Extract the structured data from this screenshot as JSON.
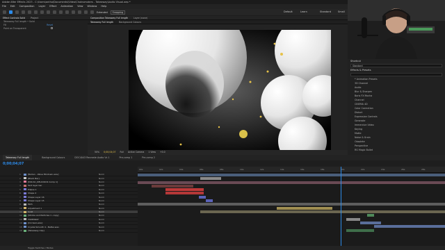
{
  "window": {
    "title": "Adobe After Effects 2023 - C:\\Users\\antho\\Documents\\Video\\Chainsmokers - Takeaway\\Audio Visual.aep *"
  },
  "menu": [
    "File",
    "Edit",
    "Composition",
    "Layer",
    "Effect",
    "Animation",
    "View",
    "Window",
    "Help"
  ],
  "toolbar": {
    "extended": "Extended",
    "snapping": "Snapping"
  },
  "workspaces": [
    "Default",
    "Learn",
    "Standard",
    "Small Screen",
    "Libraries"
  ],
  "left_panel": {
    "tabs": [
      "Effect Controls Solid",
      "Project"
    ],
    "breadcrumb": "Takeaway Full length • Solid",
    "rows": [
      {
        "label": "Fill",
        "value": "Reset"
      },
      {
        "label": "Paint on Transparent",
        "value": ""
      }
    ]
  },
  "comp_panel": {
    "tabs": [
      "Composition Takeaway Full length",
      "Layer (none)"
    ],
    "subtabs": [
      "Takeaway Full length",
      "Background Colours"
    ],
    "footer": [
      "50%",
      "0;00;04;07",
      "Full",
      "Active Camera",
      "1 View",
      "+0.0"
    ]
  },
  "right_panel": {
    "title": "Shortcut",
    "field_value": "Standard",
    "section": "Effects & Presets",
    "search_placeholder": "",
    "items": [
      "* Animation Presets",
      "3D Channel",
      "Audio",
      "Blur & Sharpen",
      "Boris FX Mocha",
      "Channel",
      "CINEMA 4D",
      "Color Correction",
      "Distort",
      "Expression Controls",
      "Generate",
      "Immersive Video",
      "Keying",
      "Matte",
      "Noise & Grain",
      "Obsolete",
      "Perspective",
      "RG Magic Bullet"
    ]
  },
  "timeline": {
    "tabs": [
      "Takeaway Full length",
      "Background Colours",
      "DOC4043 Recreate Audio Vs 1",
      "Pre-comp 1",
      "Pre-comp 2"
    ],
    "timecode": "0;00;04;07",
    "ruler": [
      "00s",
      "02s",
      "04s",
      "06s",
      "08s",
      "10s",
      "12s",
      "14s",
      "16s",
      "18s",
      "20s",
      "22s",
      "24s",
      "26s",
      "28s"
    ],
    "layers": [
      {
        "num": "1",
        "name": "[Nullen - Wave Mixdown.wav]",
        "color": "#6d8fc9",
        "mode": "Norm"
      },
      {
        "num": "2",
        "name": "[Black Bar]",
        "color": "#c8c8c8",
        "mode": "Norm"
      },
      {
        "num": "3",
        "name": "[MIX-SC_DELICIOUS Comp 1]",
        "color": "#e07a9a",
        "mode": "Norm"
      },
      {
        "num": "4",
        "name": "Text layer bar",
        "color": "#c46d6d",
        "mode": "Norm"
      },
      {
        "num": "5",
        "name": "Ellipse 1",
        "color": "#7a7ad6",
        "mode": "Norm"
      },
      {
        "num": "6",
        "name": "Shape 2",
        "color": "#7a7ad6",
        "mode": "Norm"
      },
      {
        "num": "7",
        "name": "Shape Layer 16",
        "color": "#7a7ad6",
        "mode": "Norm"
      },
      {
        "num": "8",
        "name": "Shape Layer 15",
        "color": "#7a7ad6",
        "mode": "Norm"
      },
      {
        "num": "9",
        "name": "Path",
        "color": "#b7b7b7",
        "mode": "Norm"
      },
      {
        "num": "10",
        "name": "Adjustment 1",
        "color": "#d0b36a",
        "mode": "Norm"
      },
      {
        "num": "11",
        "name": "Solid",
        "color": "#d0b36a",
        "mode": "Norm"
      },
      {
        "num": "12",
        "name": "[Strobe and Particles 1 -copy]",
        "color": "#6ab07a",
        "mode": "Norm"
      },
      {
        "num": "13",
        "name": "TAKEAWAY",
        "color": "#b7b7b7",
        "mode": "Norm"
      },
      {
        "num": "14",
        "name": "[Circles1.wav]",
        "color": "#6d8fc9",
        "mode": "Norm"
      },
      {
        "num": "15",
        "name": "Crystal Smooth 4 - Better.wav",
        "color": "#6d8fc9",
        "mode": "Norm"
      },
      {
        "num": "16",
        "name": "[Takeaway Clip]",
        "color": "#6ab07a",
        "mode": "Norm"
      }
    ],
    "footer": "Toggle Switches / Modes"
  },
  "colors": {
    "accent": "#2d8ceb",
    "panel": "#232323"
  }
}
